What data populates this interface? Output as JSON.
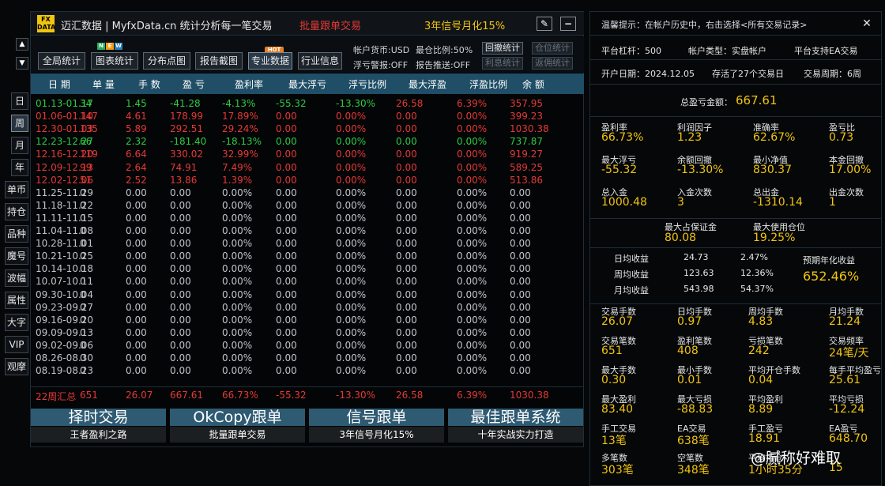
{
  "header": {
    "logo": "FX DATA",
    "title": "迈汇数据 | MyfxData.cn  统计分析每一笔交易",
    "promo_red": "批量跟单交易",
    "promo_yellow": "3年信号月化15%"
  },
  "toolbar": {
    "buttons": [
      "全局统计",
      "图表统计",
      "分布点图",
      "报告截图",
      "专业数据",
      "行业信息"
    ],
    "selected": "专业数据",
    "badges": {
      "new": "N E W",
      "hot": "HOT"
    },
    "currency": "帐户货币:USD",
    "max_position": "最仓比例:50%",
    "float_alert": "浮亏警报:OFF",
    "report_push": "报告推送:OFF",
    "small_buttons": [
      "回撤统计",
      "仓位统计",
      "利息统计",
      "返佣统计"
    ]
  },
  "table": {
    "headers": [
      "日 期",
      "单 量",
      "手 数",
      "盈 亏",
      "盈利率",
      "最大浮亏",
      "浮亏比例",
      "最大浮盈",
      "浮盈比例",
      "余 额"
    ],
    "rows": [
      {
        "date": "01.13-01.17",
        "orders": "34",
        "lots": "1.45",
        "pl": "-41.28",
        "rate": "-4.13%",
        "maxdd": "-55.32",
        "ddpct": "-13.30%",
        "maxfp": "26.58",
        "fppct": "6.39%",
        "bal": "357.95",
        "tone": "green"
      },
      {
        "date": "01.06-01.10",
        "orders": "147",
        "lots": "4.61",
        "pl": "178.99",
        "rate": "17.89%",
        "maxdd": "0.00",
        "ddpct": "0.00%",
        "maxfp": "0.00",
        "fppct": "0.00%",
        "bal": "399.23",
        "tone": "red"
      },
      {
        "date": "12.30-01.03",
        "orders": "135",
        "lots": "5.89",
        "pl": "292.51",
        "rate": "29.24%",
        "maxdd": "0.00",
        "ddpct": "0.00%",
        "maxfp": "0.00",
        "fppct": "0.00%",
        "bal": "1030.38",
        "tone": "red"
      },
      {
        "date": "12.23-12.27",
        "orders": "66",
        "lots": "2.32",
        "pl": "-181.40",
        "rate": "-18.13%",
        "maxdd": "0.00",
        "ddpct": "0.00%",
        "maxfp": "0.00",
        "fppct": "0.00%",
        "bal": "737.87",
        "tone": "green"
      },
      {
        "date": "12.16-12.20",
        "orders": "119",
        "lots": "6.64",
        "pl": "330.02",
        "rate": "32.99%",
        "maxdd": "0.00",
        "ddpct": "0.00%",
        "maxfp": "0.00",
        "fppct": "0.00%",
        "bal": "919.27",
        "tone": "red"
      },
      {
        "date": "12.09-12.13",
        "orders": "99",
        "lots": "2.64",
        "pl": "74.91",
        "rate": "7.49%",
        "maxdd": "0.00",
        "ddpct": "0.00%",
        "maxfp": "0.00",
        "fppct": "0.00%",
        "bal": "589.25",
        "tone": "red"
      },
      {
        "date": "12.02-12.06",
        "orders": "51",
        "lots": "2.52",
        "pl": "13.86",
        "rate": "1.39%",
        "maxdd": "0.00",
        "ddpct": "0.00%",
        "maxfp": "0.00",
        "fppct": "0.00%",
        "bal": "513.86",
        "tone": "red"
      },
      {
        "date": "11.25-11.29",
        "orders": "0",
        "lots": "0.00",
        "pl": "0.00",
        "rate": "0.00%",
        "maxdd": "0.00",
        "ddpct": "0.00%",
        "maxfp": "0.00",
        "fppct": "0.00%",
        "bal": "0.00",
        "tone": "gray"
      },
      {
        "date": "11.18-11.22",
        "orders": "0",
        "lots": "0.00",
        "pl": "0.00",
        "rate": "0.00%",
        "maxdd": "0.00",
        "ddpct": "0.00%",
        "maxfp": "0.00",
        "fppct": "0.00%",
        "bal": "0.00",
        "tone": "gray"
      },
      {
        "date": "11.11-11.15",
        "orders": "0",
        "lots": "0.00",
        "pl": "0.00",
        "rate": "0.00%",
        "maxdd": "0.00",
        "ddpct": "0.00%",
        "maxfp": "0.00",
        "fppct": "0.00%",
        "bal": "0.00",
        "tone": "gray"
      },
      {
        "date": "11.04-11.08",
        "orders": "0",
        "lots": "0.00",
        "pl": "0.00",
        "rate": "0.00%",
        "maxdd": "0.00",
        "ddpct": "0.00%",
        "maxfp": "0.00",
        "fppct": "0.00%",
        "bal": "0.00",
        "tone": "gray"
      },
      {
        "date": "10.28-11.01",
        "orders": "0",
        "lots": "0.00",
        "pl": "0.00",
        "rate": "0.00%",
        "maxdd": "0.00",
        "ddpct": "0.00%",
        "maxfp": "0.00",
        "fppct": "0.00%",
        "bal": "0.00",
        "tone": "gray"
      },
      {
        "date": "10.21-10.25",
        "orders": "0",
        "lots": "0.00",
        "pl": "0.00",
        "rate": "0.00%",
        "maxdd": "0.00",
        "ddpct": "0.00%",
        "maxfp": "0.00",
        "fppct": "0.00%",
        "bal": "0.00",
        "tone": "gray"
      },
      {
        "date": "10.14-10.18",
        "orders": "0",
        "lots": "0.00",
        "pl": "0.00",
        "rate": "0.00%",
        "maxdd": "0.00",
        "ddpct": "0.00%",
        "maxfp": "0.00",
        "fppct": "0.00%",
        "bal": "0.00",
        "tone": "gray"
      },
      {
        "date": "10.07-10.11",
        "orders": "0",
        "lots": "0.00",
        "pl": "0.00",
        "rate": "0.00%",
        "maxdd": "0.00",
        "ddpct": "0.00%",
        "maxfp": "0.00",
        "fppct": "0.00%",
        "bal": "0.00",
        "tone": "gray"
      },
      {
        "date": "09.30-10.04",
        "orders": "0",
        "lots": "0.00",
        "pl": "0.00",
        "rate": "0.00%",
        "maxdd": "0.00",
        "ddpct": "0.00%",
        "maxfp": "0.00",
        "fppct": "0.00%",
        "bal": "0.00",
        "tone": "gray"
      },
      {
        "date": "09.23-09.27",
        "orders": "0",
        "lots": "0.00",
        "pl": "0.00",
        "rate": "0.00%",
        "maxdd": "0.00",
        "ddpct": "0.00%",
        "maxfp": "0.00",
        "fppct": "0.00%",
        "bal": "0.00",
        "tone": "gray"
      },
      {
        "date": "09.16-09.20",
        "orders": "0",
        "lots": "0.00",
        "pl": "0.00",
        "rate": "0.00%",
        "maxdd": "0.00",
        "ddpct": "0.00%",
        "maxfp": "0.00",
        "fppct": "0.00%",
        "bal": "0.00",
        "tone": "gray"
      },
      {
        "date": "09.09-09.13",
        "orders": "0",
        "lots": "0.00",
        "pl": "0.00",
        "rate": "0.00%",
        "maxdd": "0.00",
        "ddpct": "0.00%",
        "maxfp": "0.00",
        "fppct": "0.00%",
        "bal": "0.00",
        "tone": "gray"
      },
      {
        "date": "09.02-09.06",
        "orders": "0",
        "lots": "0.00",
        "pl": "0.00",
        "rate": "0.00%",
        "maxdd": "0.00",
        "ddpct": "0.00%",
        "maxfp": "0.00",
        "fppct": "0.00%",
        "bal": "0.00",
        "tone": "gray"
      },
      {
        "date": "08.26-08.30",
        "orders": "0",
        "lots": "0.00",
        "pl": "0.00",
        "rate": "0.00%",
        "maxdd": "0.00",
        "ddpct": "0.00%",
        "maxfp": "0.00",
        "fppct": "0.00%",
        "bal": "0.00",
        "tone": "gray"
      },
      {
        "date": "08.19-08.23",
        "orders": "0",
        "lots": "0.00",
        "pl": "0.00",
        "rate": "0.00%",
        "maxdd": "0.00",
        "ddpct": "0.00%",
        "maxfp": "0.00",
        "fppct": "0.00%",
        "bal": "0.00",
        "tone": "gray"
      }
    ],
    "summary": {
      "date": "22周汇总",
      "orders": "651",
      "lots": "26.07",
      "pl": "667.61",
      "rate": "66.73%",
      "maxdd": "-55.32",
      "ddpct": "-13.30%",
      "maxfp": "26.58",
      "fppct": "6.39%",
      "bal": "1030.38"
    }
  },
  "bottom_buttons": [
    {
      "title": "择时交易",
      "sub": "王者盈利之路"
    },
    {
      "title": "OkCopy跟单",
      "sub": "批量跟单交易"
    },
    {
      "title": "信号跟单",
      "sub": "3年信号月化15%"
    },
    {
      "title": "最佳跟单系统",
      "sub": "十年实战实力打造"
    }
  ],
  "side_nav": {
    "period": [
      "日",
      "周",
      "月",
      "年"
    ],
    "selected": "周",
    "filters": [
      "单币",
      "持仓",
      "品种",
      "魔号",
      "波幅",
      "属性",
      "大字",
      "VIP",
      "观摩"
    ],
    "scroll_up": "▲",
    "scroll_down": "▼"
  },
  "right": {
    "tip": "温馨提示：在帐户历史中，右击选择<所有交易记录>",
    "platform": {
      "leverage": "平台杠杆：500",
      "account_type": "帐户类型：实盘帐户",
      "ea": "平台支持EA交易"
    },
    "dates": {
      "open": "开户日期：2024.12.05",
      "days": "存活了27个交易日",
      "period": "交易周期：6周"
    },
    "total": {
      "label": "总盈亏金额：",
      "value": "667.61"
    },
    "block1": [
      {
        "label": "盈利率",
        "value": "66.73%"
      },
      {
        "label": "利润因子",
        "value": "1.23"
      },
      {
        "label": "准确率",
        "value": "62.67%"
      },
      {
        "label": "盈亏比",
        "value": "0.73"
      },
      {
        "label": "最大浮亏",
        "value": "-55.32"
      },
      {
        "label": "余额回撤",
        "value": "-13.30%"
      },
      {
        "label": "最小净值",
        "value": "830.37"
      },
      {
        "label": "本金回撤",
        "value": "17.00%"
      },
      {
        "label": "总入金",
        "value": "1000.48"
      },
      {
        "label": "入金次数",
        "value": "3"
      },
      {
        "label": "总出金",
        "value": "-1310.14"
      },
      {
        "label": "出金次数",
        "value": "1"
      }
    ],
    "margin": [
      {
        "label": "最大占保证金",
        "value": "80.08"
      },
      {
        "label": "最大使用仓位",
        "value": "19.25%"
      }
    ],
    "daily": [
      {
        "label": "日均收益",
        "amount": "24.73",
        "pct": "2.47%"
      },
      {
        "label": "周均收益",
        "amount": "123.63",
        "pct": "12.36%"
      },
      {
        "label": "月均收益",
        "amount": "543.98",
        "pct": "54.37%"
      }
    ],
    "annual": {
      "label": "预期年化收益",
      "value": "652.46%"
    },
    "block2": [
      {
        "label": "交易手数",
        "value": "26.07"
      },
      {
        "label": "日均手数",
        "value": "0.97"
      },
      {
        "label": "周均手数",
        "value": "4.83"
      },
      {
        "label": "月均手数",
        "value": "21.24"
      },
      {
        "label": "交易笔数",
        "value": "651"
      },
      {
        "label": "盈利笔数",
        "value": "408"
      },
      {
        "label": "亏损笔数",
        "value": "242"
      },
      {
        "label": "交易频率",
        "value": "24笔/天"
      },
      {
        "label": "最大手数",
        "value": "0.30"
      },
      {
        "label": "最小手数",
        "value": "0.01"
      },
      {
        "label": "平均开仓手数",
        "value": "0.04"
      },
      {
        "label": "每手平均盈亏",
        "value": "25.61"
      },
      {
        "label": "最大盈利",
        "value": "83.40"
      },
      {
        "label": "最大亏损",
        "value": "-88.83"
      },
      {
        "label": "平均盈利",
        "value": "8.89"
      },
      {
        "label": "平均亏损",
        "value": "-12.24"
      },
      {
        "label": "手工交易",
        "value": "13笔"
      },
      {
        "label": "EA交易",
        "value": "638笔"
      },
      {
        "label": "手工盈亏",
        "value": "18.91"
      },
      {
        "label": "EA盈亏",
        "value": "648.70"
      },
      {
        "label": "多笔数",
        "value": "303笔"
      },
      {
        "label": "空笔数",
        "value": "348笔"
      },
      {
        "label": "平均持仓",
        "value": "1小时35分"
      },
      {
        "label": "",
        "value": "15"
      }
    ]
  },
  "watermark": "@腻称好难取"
}
